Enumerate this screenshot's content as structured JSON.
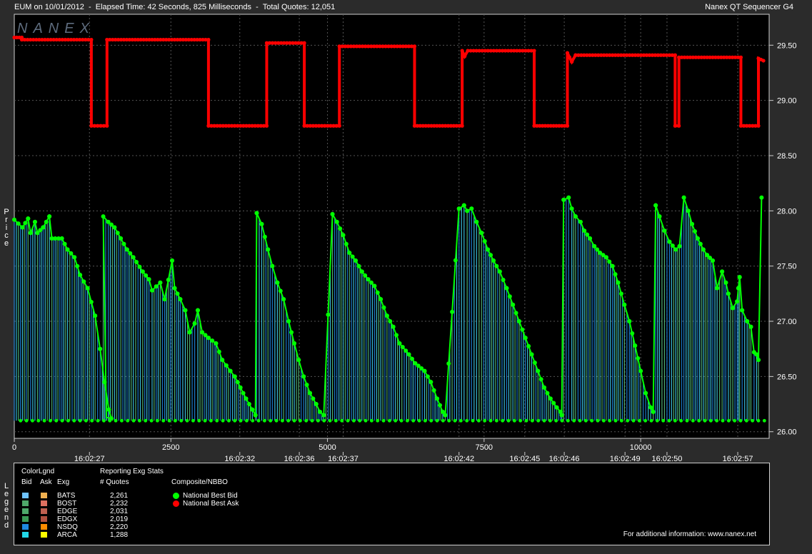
{
  "header": {
    "left_text": "EUM on 10/01/2012  -  Elapsed Time: 42 Seconds, 825 Milliseconds  -  Total Quotes: 12,051",
    "right_text": "Nanex QT Sequencer G4",
    "watermark": "NANEX"
  },
  "axis_labels": {
    "y": "Price",
    "legend_side": "Legend"
  },
  "chart_data": {
    "type": "line",
    "title": "",
    "xlabel": "",
    "ylabel": "Price",
    "xlim": [
      0,
      12051
    ],
    "ylim": [
      25.94,
      29.78
    ],
    "x_ticks": [
      0,
      2500,
      5000,
      7500,
      10000
    ],
    "y_ticks": [
      26.0,
      26.5,
      27.0,
      27.5,
      28.0,
      28.5,
      29.0,
      29.5
    ],
    "y_tick_labels": [
      "26.00",
      "26.50",
      "27.00",
      "27.50",
      "28.00",
      "28.50",
      "29.00",
      "29.50"
    ],
    "time_ticks": [
      {
        "x": 1200,
        "label": "16:02:27"
      },
      {
        "x": 3600,
        "label": "16:02:32"
      },
      {
        "x": 4550,
        "label": "16:02:36"
      },
      {
        "x": 5250,
        "label": "16:02:37"
      },
      {
        "x": 7100,
        "label": "16:02:42"
      },
      {
        "x": 8150,
        "label": "16:02:45"
      },
      {
        "x": 8780,
        "label": "16:02:46"
      },
      {
        "x": 9750,
        "label": "16:02:49"
      },
      {
        "x": 10420,
        "label": "16:02:50"
      },
      {
        "x": 11550,
        "label": "16:02:57"
      }
    ],
    "grid": true,
    "series": [
      {
        "name": "National Best Ask",
        "color": "#ff0000",
        "points": [
          [
            0,
            29.57
          ],
          [
            120,
            29.57
          ],
          [
            120,
            29.55
          ],
          [
            1230,
            29.55
          ],
          [
            1230,
            28.77
          ],
          [
            1480,
            28.77
          ],
          [
            1480,
            29.55
          ],
          [
            3100,
            29.55
          ],
          [
            3100,
            28.77
          ],
          [
            4030,
            28.77
          ],
          [
            4030,
            29.52
          ],
          [
            4630,
            29.52
          ],
          [
            4630,
            28.77
          ],
          [
            5190,
            28.77
          ],
          [
            5190,
            29.49
          ],
          [
            6390,
            29.49
          ],
          [
            6390,
            28.77
          ],
          [
            7150,
            28.77
          ],
          [
            7150,
            29.45
          ],
          [
            7190,
            29.4
          ],
          [
            7240,
            29.45
          ],
          [
            8300,
            29.45
          ],
          [
            8300,
            28.77
          ],
          [
            8830,
            28.77
          ],
          [
            8830,
            29.43
          ],
          [
            8900,
            29.35
          ],
          [
            8960,
            29.41
          ],
          [
            10550,
            29.41
          ],
          [
            10550,
            28.77
          ],
          [
            10610,
            28.77
          ],
          [
            10610,
            29.39
          ],
          [
            11600,
            29.39
          ],
          [
            11600,
            28.77
          ],
          [
            11880,
            28.77
          ],
          [
            11880,
            29.38
          ],
          [
            11960,
            29.36
          ]
        ]
      },
      {
        "name": "National Best Bid",
        "color": "#00ff00",
        "points": [
          [
            0,
            27.92
          ],
          [
            130,
            27.85
          ],
          [
            220,
            27.93
          ],
          [
            260,
            27.8
          ],
          [
            330,
            27.9
          ],
          [
            370,
            27.8
          ],
          [
            460,
            27.85
          ],
          [
            560,
            27.95
          ],
          [
            600,
            27.75
          ],
          [
            760,
            27.75
          ],
          [
            850,
            27.65
          ],
          [
            960,
            27.58
          ],
          [
            1050,
            27.42
          ],
          [
            1170,
            27.3
          ],
          [
            1290,
            27.05
          ],
          [
            1370,
            26.75
          ],
          [
            1440,
            26.45
          ],
          [
            1510,
            26.2
          ],
          [
            1550,
            26.12
          ],
          [
            1470,
            26.13
          ],
          [
            1420,
            27.95
          ],
          [
            1500,
            27.9
          ],
          [
            1600,
            27.85
          ],
          [
            1700,
            27.75
          ],
          [
            1800,
            27.65
          ],
          [
            1900,
            27.58
          ],
          [
            2050,
            27.45
          ],
          [
            2150,
            27.38
          ],
          [
            2200,
            27.28
          ],
          [
            2330,
            27.35
          ],
          [
            2400,
            27.2
          ],
          [
            2520,
            27.55
          ],
          [
            2560,
            27.3
          ],
          [
            2650,
            27.2
          ],
          [
            2730,
            27.1
          ],
          [
            2800,
            26.9
          ],
          [
            2880,
            26.98
          ],
          [
            2930,
            27.1
          ],
          [
            3000,
            26.9
          ],
          [
            3100,
            26.85
          ],
          [
            3220,
            26.8
          ],
          [
            3320,
            26.65
          ],
          [
            3450,
            26.55
          ],
          [
            3520,
            26.5
          ],
          [
            3610,
            26.4
          ],
          [
            3700,
            26.3
          ],
          [
            3800,
            26.2
          ],
          [
            3850,
            26.15
          ],
          [
            3870,
            27.98
          ],
          [
            3950,
            27.88
          ],
          [
            4050,
            27.65
          ],
          [
            4120,
            27.5
          ],
          [
            4200,
            27.35
          ],
          [
            4300,
            27.2
          ],
          [
            4380,
            27.0
          ],
          [
            4470,
            26.8
          ],
          [
            4540,
            26.65
          ],
          [
            4620,
            26.5
          ],
          [
            4720,
            26.35
          ],
          [
            4820,
            26.25
          ],
          [
            4880,
            26.18
          ],
          [
            4940,
            26.15
          ],
          [
            5080,
            27.97
          ],
          [
            5150,
            27.9
          ],
          [
            5250,
            27.78
          ],
          [
            5350,
            27.62
          ],
          [
            5450,
            27.55
          ],
          [
            5550,
            27.45
          ],
          [
            5650,
            27.38
          ],
          [
            5750,
            27.32
          ],
          [
            5850,
            27.2
          ],
          [
            5950,
            27.05
          ],
          [
            6050,
            26.95
          ],
          [
            6150,
            26.8
          ],
          [
            6300,
            26.7
          ],
          [
            6400,
            26.62
          ],
          [
            6550,
            26.55
          ],
          [
            6650,
            26.45
          ],
          [
            6750,
            26.3
          ],
          [
            6840,
            26.18
          ],
          [
            6880,
            26.15
          ],
          [
            7100,
            28.02
          ],
          [
            7180,
            28.05
          ],
          [
            7230,
            28.0
          ],
          [
            7300,
            28.02
          ],
          [
            7380,
            27.9
          ],
          [
            7460,
            27.8
          ],
          [
            7560,
            27.65
          ],
          [
            7650,
            27.55
          ],
          [
            7750,
            27.45
          ],
          [
            7860,
            27.3
          ],
          [
            7960,
            27.15
          ],
          [
            8060,
            27.0
          ],
          [
            8160,
            26.85
          ],
          [
            8260,
            26.7
          ],
          [
            8360,
            26.55
          ],
          [
            8460,
            26.4
          ],
          [
            8560,
            26.3
          ],
          [
            8660,
            26.22
          ],
          [
            8720,
            26.18
          ],
          [
            8740,
            26.15
          ],
          [
            8770,
            28.1
          ],
          [
            8850,
            28.12
          ],
          [
            8900,
            28.02
          ],
          [
            8960,
            27.95
          ],
          [
            9040,
            27.9
          ],
          [
            9100,
            27.82
          ],
          [
            9190,
            27.75
          ],
          [
            9260,
            27.68
          ],
          [
            9350,
            27.62
          ],
          [
            9450,
            27.58
          ],
          [
            9550,
            27.5
          ],
          [
            9640,
            27.35
          ],
          [
            9740,
            27.15
          ],
          [
            9820,
            27.0
          ],
          [
            9910,
            26.78
          ],
          [
            10000,
            26.55
          ],
          [
            10080,
            26.35
          ],
          [
            10160,
            26.22
          ],
          [
            10200,
            26.18
          ],
          [
            10240,
            28.05
          ],
          [
            10300,
            27.95
          ],
          [
            10380,
            27.82
          ],
          [
            10460,
            27.72
          ],
          [
            10560,
            27.65
          ],
          [
            10620,
            27.68
          ],
          [
            10690,
            28.12
          ],
          [
            10760,
            28.0
          ],
          [
            10820,
            27.88
          ],
          [
            10910,
            27.75
          ],
          [
            11000,
            27.65
          ],
          [
            11060,
            27.6
          ],
          [
            11150,
            27.55
          ],
          [
            11220,
            27.3
          ],
          [
            11300,
            27.45
          ],
          [
            11360,
            27.35
          ],
          [
            11400,
            27.25
          ],
          [
            11470,
            27.12
          ],
          [
            11540,
            27.18
          ],
          [
            11560,
            27.3
          ],
          [
            11580,
            27.4
          ],
          [
            11620,
            27.1
          ],
          [
            11700,
            27.0
          ],
          [
            11760,
            26.95
          ],
          [
            11810,
            26.72
          ],
          [
            11850,
            26.7
          ],
          [
            11880,
            26.65
          ],
          [
            11930,
            28.12
          ]
        ]
      }
    ],
    "bid_color_region_bottom": 26.1,
    "series_colors": {
      "nbb_dot": "#00ff00",
      "nbo_dot": "#ff0000",
      "bid_fill_a": "#1f88e0",
      "bid_fill_b": "#3fd0f0",
      "bid_fill_c": "#55c080"
    }
  },
  "legend": {
    "color_legend_title": "ColorLgnd",
    "col_bid": "Bid",
    "col_ask": "Ask",
    "col_exg": "Exg",
    "stats_title": "Reporting Exg Stats",
    "stats_subtitle": "# Quotes",
    "composite_title": "Composite/NBBO",
    "nbb_label": "National Best Bid",
    "nbo_label": "National Best Ask",
    "footer": "For additional information: www.nanex.net",
    "exchanges": [
      {
        "name": "BATS",
        "count": "2,261",
        "bid_color": "#6ec3ff",
        "ask_color": "#f0b050"
      },
      {
        "name": "BOST",
        "count": "2,232",
        "bid_color": "#4fa86a",
        "ask_color": "#e07060"
      },
      {
        "name": "EDGE",
        "count": "2,031",
        "bid_color": "#4ea86a",
        "ask_color": "#c06050"
      },
      {
        "name": "EDGX",
        "count": "2,019",
        "bid_color": "#3a9a55",
        "ask_color": "#b05040"
      },
      {
        "name": "NSDQ",
        "count": "2,220",
        "bid_color": "#1f88e0",
        "ask_color": "#ff8c00"
      },
      {
        "name": "ARCA",
        "count": "1,288",
        "bid_color": "#22d8e8",
        "ask_color": "#ffff00"
      }
    ]
  }
}
